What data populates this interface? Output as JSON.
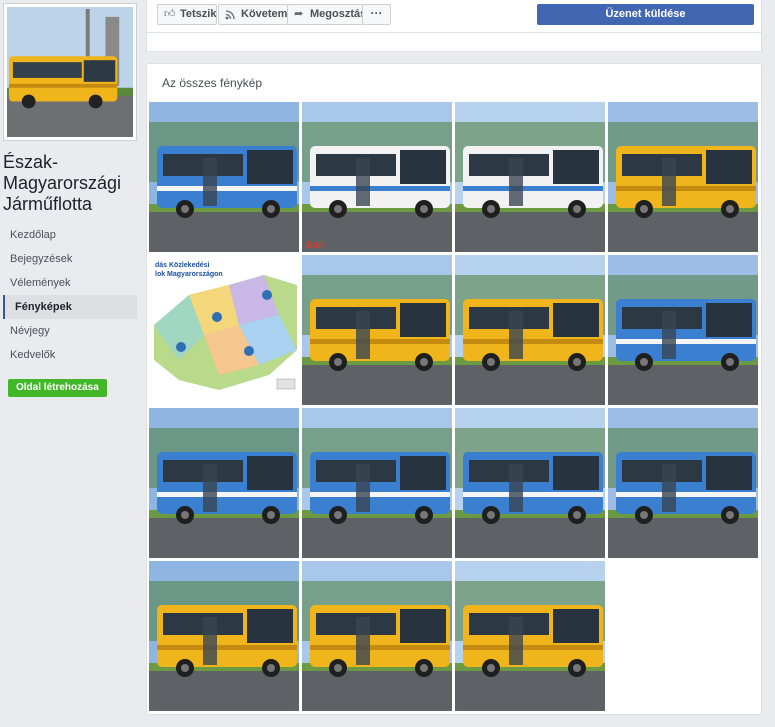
{
  "page": {
    "name": "Észak-Magyarországi Járműflotta"
  },
  "nav": {
    "items": [
      {
        "label": "Kezdőlap",
        "active": false
      },
      {
        "label": "Bejegyzések",
        "active": false
      },
      {
        "label": "Vélemények",
        "active": false
      },
      {
        "label": "Fényképek",
        "active": true
      },
      {
        "label": "Névjegy",
        "active": false
      },
      {
        "label": "Kedvelők",
        "active": false
      }
    ],
    "create_page_label": "Oldal létrehozása"
  },
  "actions": {
    "like_label": "Tetszik",
    "follow_label": "Követem",
    "share_label": "Megosztás",
    "more_label": "···",
    "send_message_label": "Üzenet küldése"
  },
  "photos": {
    "title": "Az összes fénykép",
    "items": [
      {
        "subject": "blue-bus"
      },
      {
        "subject": "white-bus",
        "watermark": "Bolt"
      },
      {
        "subject": "white-bus"
      },
      {
        "subject": "yellow-bus"
      },
      {
        "subject": "map",
        "map_caption": "dás Közlekedési\nlok Magyarországon"
      },
      {
        "subject": "yellow-bus"
      },
      {
        "subject": "yellow-bus"
      },
      {
        "subject": "blue-bus"
      },
      {
        "subject": "blue-bus"
      },
      {
        "subject": "blue-bus"
      },
      {
        "subject": "blue-bus"
      },
      {
        "subject": "blue-bus"
      },
      {
        "subject": "yellow-bus"
      },
      {
        "subject": "yellow-bus"
      },
      {
        "subject": "yellow-bus"
      }
    ]
  },
  "colors": {
    "accent": "#4267b2",
    "create_button": "#42b72a",
    "bus_blue": "#3b7fd0",
    "bus_yellow": "#f1b51c",
    "bus_white": "#f2f2f2"
  }
}
